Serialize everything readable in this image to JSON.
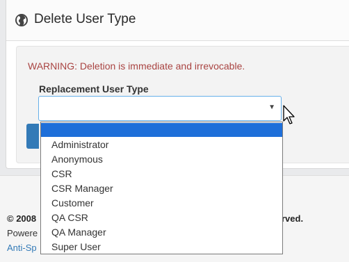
{
  "panel": {
    "title": "Delete User Type",
    "icon": "globe-icon"
  },
  "form": {
    "warning": "WARNING: Deletion is immediate and irrevocable.",
    "replacement_label": "Replacement User Type",
    "select_value": "",
    "caret_glyph": "▼",
    "options": [
      "",
      "Administrator",
      "Anonymous",
      "CSR",
      "CSR Manager",
      "Customer",
      "QA CSR",
      "QA Manager",
      "Super User"
    ]
  },
  "footer": {
    "copyright_partial": "© 2008",
    "rights_partial": "rved.",
    "powered_partial": "Powere",
    "link_partial": "Anti-Sp"
  },
  "colors": {
    "warning": "#a94442",
    "accent": "#337ab7",
    "selection": "#1e6fd9"
  }
}
